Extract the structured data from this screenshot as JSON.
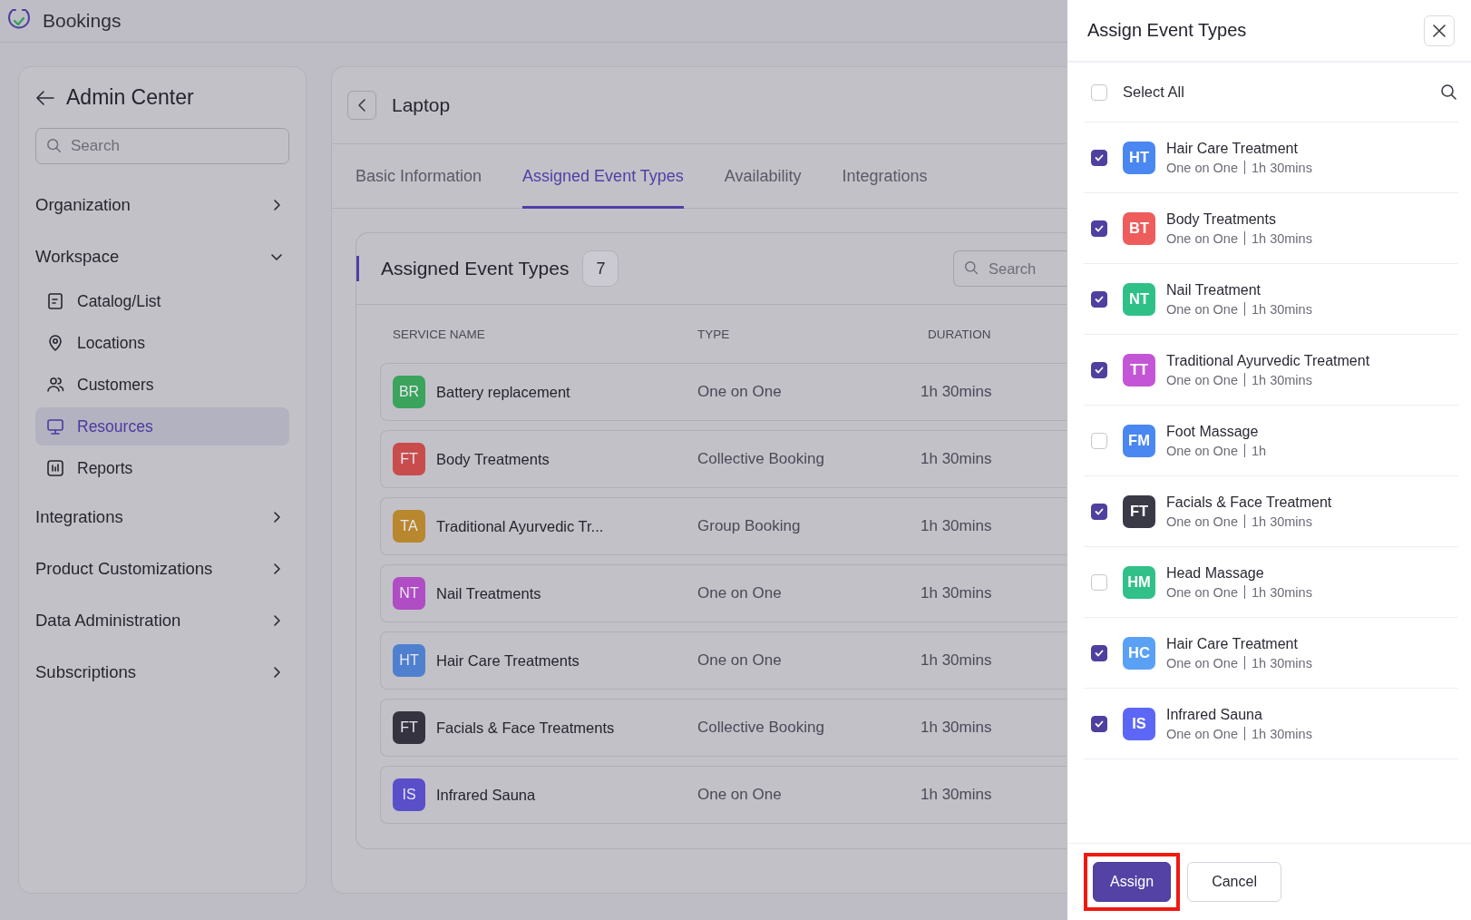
{
  "app": {
    "name": "Bookings"
  },
  "sidebar": {
    "title": "Admin Center",
    "search": {
      "placeholder": "Search"
    },
    "items": [
      {
        "label": "Organization",
        "expanded": false
      },
      {
        "label": "Workspace",
        "expanded": true,
        "children": [
          {
            "label": "Catalog/List",
            "selected": false
          },
          {
            "label": "Locations",
            "selected": false
          },
          {
            "label": "Customers",
            "selected": false
          },
          {
            "label": "Resources",
            "selected": true
          },
          {
            "label": "Reports",
            "selected": false
          }
        ]
      },
      {
        "label": "Integrations",
        "expanded": false
      },
      {
        "label": "Product Customizations",
        "expanded": false
      },
      {
        "label": "Data Administration",
        "expanded": false
      },
      {
        "label": "Subscriptions",
        "expanded": false
      }
    ]
  },
  "resource": {
    "title": "Laptop",
    "tabs": [
      {
        "label": "Basic Information",
        "selected": false
      },
      {
        "label": "Assigned Event Types",
        "selected": true
      },
      {
        "label": "Availability",
        "selected": false
      },
      {
        "label": "Integrations",
        "selected": false
      }
    ],
    "panel": {
      "title": "Assigned Event Types",
      "count": "7",
      "search": {
        "placeholder": "Search"
      },
      "table": {
        "columns": [
          "SERVICE NAME",
          "TYPE",
          "DURATION"
        ],
        "rows": [
          {
            "initials": "BR",
            "color": "#3aa35c",
            "name": "Battery replacement",
            "type": "One on One",
            "duration": "1h 30mins"
          },
          {
            "initials": "FT",
            "color": "#c94c4c",
            "name": "Body Treatments",
            "type": "Collective Booking",
            "duration": "1h 30mins"
          },
          {
            "initials": "TA",
            "color": "#b8872e",
            "name": "Traditional Ayurvedic Tr...",
            "type": "Group Booking",
            "duration": "1h 30mins"
          },
          {
            "initials": "NT",
            "color": "#b04cc4",
            "name": "Nail Treatments",
            "type": "One on One",
            "duration": "1h 30mins"
          },
          {
            "initials": "HT",
            "color": "#4f80d0",
            "name": "Hair Care Treatments",
            "type": "One on One",
            "duration": "1h 30mins"
          },
          {
            "initials": "FT",
            "color": "#35333f",
            "name": "Facials & Face Treatments",
            "type": "Collective Booking",
            "duration": "1h 30mins"
          },
          {
            "initials": "IS",
            "color": "#5a4fc9",
            "name": "Infrared Sauna",
            "type": "One on One",
            "duration": "1h 30mins"
          }
        ]
      }
    }
  },
  "drawer": {
    "title": "Assign Event Types",
    "select_all": {
      "label": "Select All",
      "checked": false
    },
    "items": [
      {
        "initials": "HT",
        "color": "#4a87f0",
        "name": "Hair Care Treatment",
        "type": "One on One",
        "duration": "1h 30mins",
        "checked": true
      },
      {
        "initials": "BT",
        "color": "#ee5c5c",
        "name": "Body Treatments",
        "type": "One on One",
        "duration": "1h 30mins",
        "checked": true
      },
      {
        "initials": "NT",
        "color": "#2fc088",
        "name": "Nail Treatment",
        "type": "One on One",
        "duration": "1h 30mins",
        "checked": true
      },
      {
        "initials": "TT",
        "color": "#c455d6",
        "name": "Traditional Ayurvedic Treatment",
        "type": "One on One",
        "duration": "1h 30mins",
        "checked": true
      },
      {
        "initials": "FM",
        "color": "#4a87f0",
        "name": "Foot Massage",
        "type": "One on One",
        "duration": "1h",
        "checked": false
      },
      {
        "initials": "FT",
        "color": "#3a3946",
        "name": "Facials & Face Treatment",
        "type": "One on One",
        "duration": "1h 30mins",
        "checked": true
      },
      {
        "initials": "HM",
        "color": "#30c088",
        "name": "Head Massage",
        "type": "One on One",
        "duration": "1h 30mins",
        "checked": false
      },
      {
        "initials": "HC",
        "color": "#5aa1f5",
        "name": "Hair Care Treatment",
        "type": "One on One",
        "duration": "1h 30mins",
        "checked": true
      },
      {
        "initials": "IS",
        "color": "#5c67f5",
        "name": "Infrared Sauna",
        "type": "One on One",
        "duration": "1h 30mins",
        "checked": true
      }
    ],
    "buttons": [
      {
        "label": "Assign",
        "kind": "primary",
        "highlighted": true
      },
      {
        "label": "Cancel",
        "kind": "secondary",
        "highlighted": false
      }
    ]
  }
}
